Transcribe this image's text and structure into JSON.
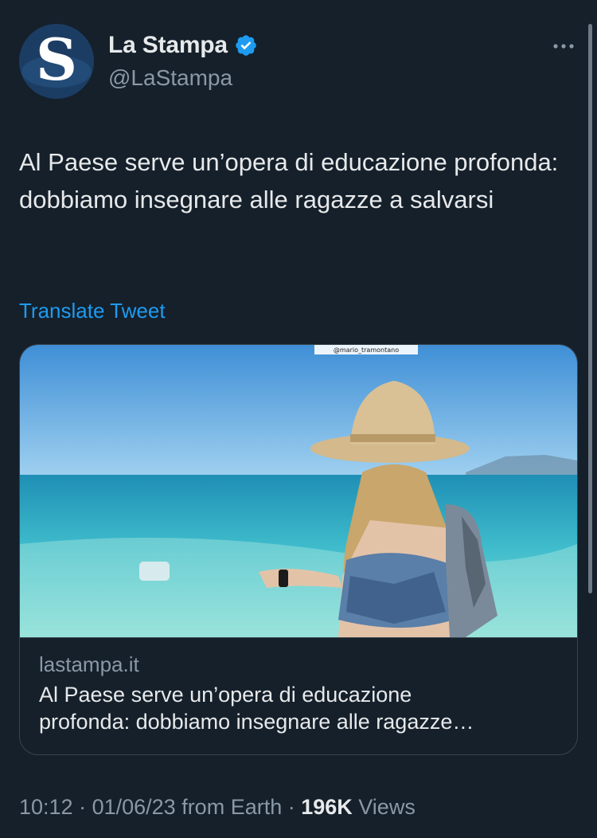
{
  "account": {
    "display_name": "La Stampa",
    "handle": "@LaStampa",
    "avatar_letter": "S",
    "verified_color": "#1d9bf0"
  },
  "tweet": {
    "text": "Al Paese serve un’opera di educazione profonda: dobbiamo insegnare alle ragazze a salvarsi",
    "translate_label": "Translate Tweet"
  },
  "card": {
    "image_watermark": "@mario_tramontano",
    "domain": "lastampa.it",
    "title_line1": "Al Paese serve un’opera di educazione",
    "title_line2": "profonda: dobbiamo insegnare alle ragazze…"
  },
  "meta": {
    "time": "10:12",
    "sep1": " · ",
    "date": "01/06/23",
    "source": " from Earth",
    "sep2": " · ",
    "views_count": "196K",
    "views_label": " Views"
  },
  "colors": {
    "background": "#15202b",
    "text": "#e7e9ea",
    "muted": "#8b98a5",
    "accent": "#1d9bf0",
    "border": "#38444d"
  },
  "icons": {
    "more": "more-icon",
    "verified": "verified-badge-icon"
  }
}
